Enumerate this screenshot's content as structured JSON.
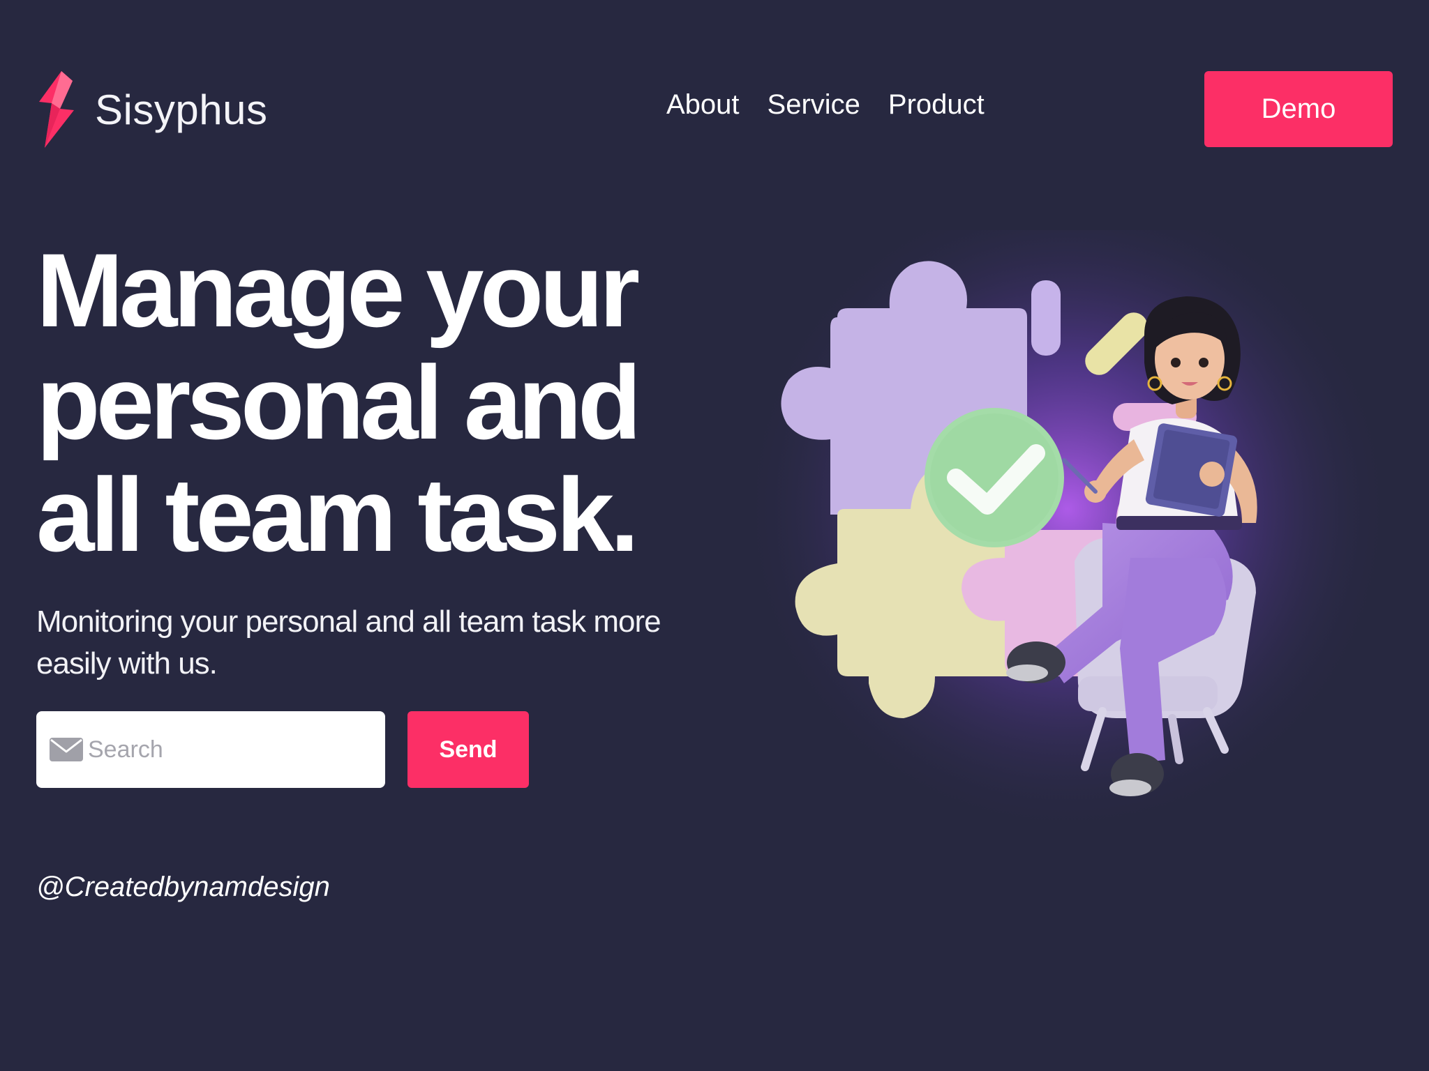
{
  "brand": {
    "name": "Sisyphus",
    "logo_icon": "lightning-bolt-logo-icon",
    "logo_colors": [
      "#fc2f66",
      "#ff6a8f"
    ]
  },
  "nav": {
    "links": [
      {
        "label": "About"
      },
      {
        "label": "Service"
      },
      {
        "label": "Product"
      }
    ],
    "demo_label": "Demo"
  },
  "hero": {
    "headline_lines": [
      "Manage your",
      "personal and",
      "all team task."
    ],
    "subtitle": "Monitoring your personal and all team task more easily with us.",
    "search": {
      "placeholder": "Search",
      "value": "",
      "icon": "mail-icon"
    },
    "send_label": "Send"
  },
  "credit": "@Createdbynamdesign",
  "theme": {
    "background": "#272840",
    "accent": "#fc2f66",
    "text": "#ffffff"
  }
}
